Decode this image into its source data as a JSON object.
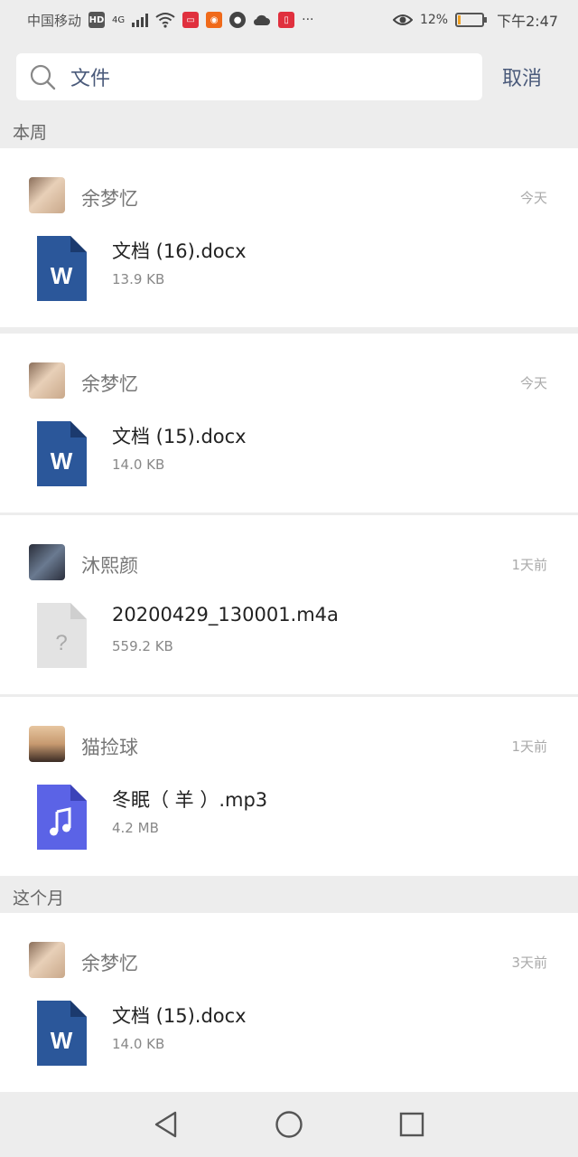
{
  "status": {
    "carrier": "中国移动",
    "network": "4G",
    "hd": "HD",
    "battery_percent": "12%",
    "battery_level": 0.12,
    "time": "下午2:47",
    "more": "···"
  },
  "search": {
    "value": "文件",
    "cancel_label": "取消"
  },
  "sections": [
    {
      "label": "本周"
    },
    {
      "label": "这个月"
    }
  ],
  "files": [
    {
      "sender": "余梦忆",
      "time": "今天",
      "name": "文档 (16).docx",
      "size": "13.9 KB",
      "icon": "word-icon",
      "avatar": "avatar-1"
    },
    {
      "sender": "余梦忆",
      "time": "今天",
      "name": "文档 (15).docx",
      "size": "14.0 KB",
      "icon": "word-icon",
      "avatar": "avatar-1"
    },
    {
      "sender": "沐熙颜",
      "time": "1天前",
      "name": "20200429_130001.m4a",
      "size": "559.2 KB",
      "icon": "unknown-file-icon",
      "avatar": "avatar-2"
    },
    {
      "sender": "猫捡球",
      "time": "1天前",
      "name": "冬眠（ 羊 ）.mp3",
      "size": "4.2 MB",
      "icon": "music-file-icon",
      "avatar": "avatar-3"
    },
    {
      "sender": "余梦忆",
      "time": "3天前",
      "name": "文档 (15).docx",
      "size": "14.0 KB",
      "icon": "word-icon",
      "avatar": "avatar-1"
    }
  ],
  "colors": {
    "word": "#2b579a",
    "music": "#5b63e6",
    "unknown": "#e3e3e3",
    "link": "#4a5a7a"
  }
}
